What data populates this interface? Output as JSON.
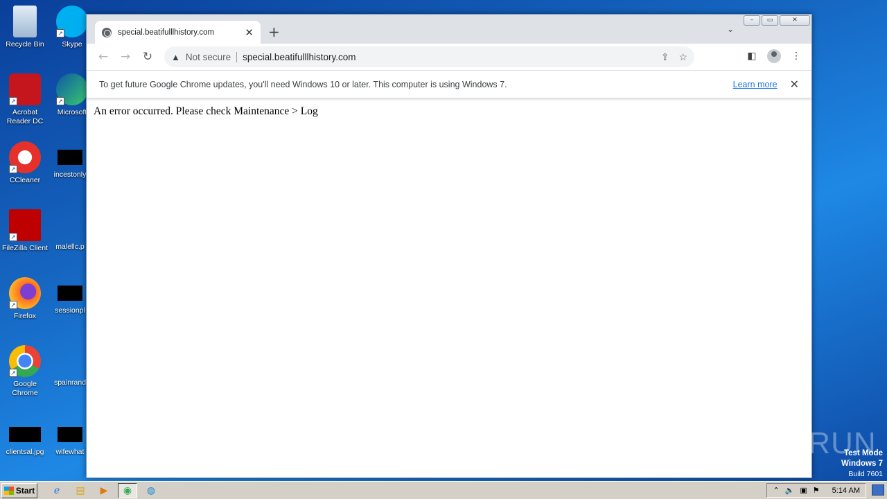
{
  "desktop": {
    "icons": [
      {
        "label": "Recycle Bin"
      },
      {
        "label": "Skype"
      },
      {
        "label": "Acrobat Reader DC"
      },
      {
        "label": "Microsoft"
      },
      {
        "label": "CCleaner"
      },
      {
        "label": "incestonly"
      },
      {
        "label": "FileZilla Client"
      },
      {
        "label": "malellc.p"
      },
      {
        "label": "Firefox"
      },
      {
        "label": "sessionpl"
      },
      {
        "label": "Google Chrome"
      },
      {
        "label": "spainrand"
      },
      {
        "label": "clientsal.jpg"
      },
      {
        "label": "wifewhat"
      }
    ]
  },
  "browser": {
    "tab": {
      "title": "special.beatifulllhistory.com"
    },
    "omnibox": {
      "security": "Not secure",
      "url": "special.beatifulllhistory.com"
    },
    "infobar": {
      "message": "To get future Google Chrome updates, you'll need Windows 10 or later. This computer is using Windows 7.",
      "link": "Learn more"
    },
    "page": {
      "text": "An error occurred. Please check Maintenance > Log"
    }
  },
  "watermark": {
    "text": "ANY▷RUN"
  },
  "testmode": {
    "line1": "Test Mode",
    "line2": "Windows 7",
    "line3": "Build 7601"
  },
  "taskbar": {
    "start": "Start",
    "clock": "5:14 AM"
  },
  "colors": {
    "link": "#1a73e8",
    "desktop": "#1565c0"
  }
}
